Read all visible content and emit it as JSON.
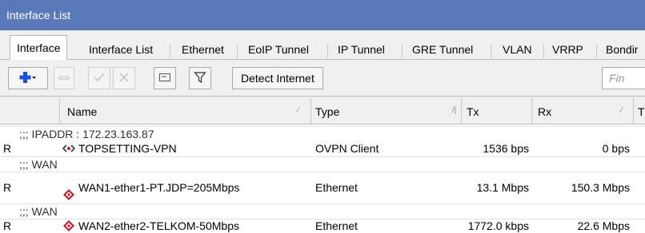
{
  "window": {
    "title": "Interface List"
  },
  "tabs": [
    {
      "label": "Interface"
    },
    {
      "label": "Interface List"
    },
    {
      "label": "Ethernet"
    },
    {
      "label": "EoIP Tunnel"
    },
    {
      "label": "IP Tunnel"
    },
    {
      "label": "GRE Tunnel"
    },
    {
      "label": "VLAN"
    },
    {
      "label": "VRRP"
    },
    {
      "label": "Bondir"
    }
  ],
  "toolbar": {
    "detect_label": "Detect Internet",
    "filter_placeholder": "Fin",
    "icons": [
      "add-icon",
      "remove-icon",
      "enable-icon",
      "disable-icon",
      "comment-icon",
      "filter-icon"
    ]
  },
  "columns": {
    "name": "Name",
    "type": "Type",
    "tx": "Tx",
    "rx": "Rx",
    "extra": "T"
  },
  "rows": [
    {
      "kind": "group",
      "label": ";;; IPADDR : 172.23.163.87"
    },
    {
      "kind": "item",
      "flag": "R",
      "icon": "ovpn-icon",
      "name": "TOPSETTING-VPN",
      "type": "OVPN Client",
      "tx": "1536 bps",
      "rx": "0 bps"
    },
    {
      "kind": "group",
      "label": ";;; WAN"
    },
    {
      "kind": "item",
      "flag": "R",
      "icon": "ethernet-icon",
      "name": "WAN1-ether1-PT.JDP=205Mbps",
      "type": "Ethernet",
      "tx": "13.1 Mbps",
      "rx": "150.3 Mbps"
    },
    {
      "kind": "group",
      "label": ";;; WAN"
    },
    {
      "kind": "item",
      "flag": "R",
      "icon": "ethernet-icon",
      "name": "WAN2-ether2-TELKOM-50Mbps",
      "type": "Ethernet",
      "tx": "1772.0 kbps",
      "rx": "22.6 Mbps"
    }
  ],
  "colors": {
    "titlebar": "#5b79b9",
    "add_blue": "#1e4fd6",
    "ethernet_red": "#c0202a"
  }
}
